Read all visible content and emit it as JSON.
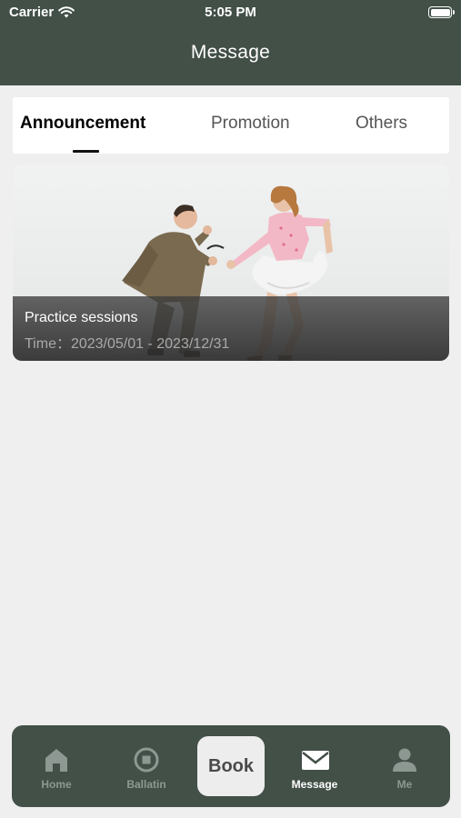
{
  "status_bar": {
    "carrier": "Carrier",
    "time": "5:05 PM"
  },
  "header": {
    "title": "Message"
  },
  "tabs": [
    {
      "label": "Announcement",
      "active": true
    },
    {
      "label": "Promotion",
      "active": false
    },
    {
      "label": "Others",
      "active": false
    }
  ],
  "announcements": [
    {
      "title": "Practice sessions",
      "time": "Time：2023/05/01 - 2023/12/31",
      "image": "dancing-couple-photo"
    }
  ],
  "tabbar": {
    "items": [
      {
        "label": "Home",
        "icon": "home-icon",
        "active": false
      },
      {
        "label": "Ballatin",
        "icon": "circle-stop-icon",
        "active": false
      },
      {
        "label": "Book",
        "icon": "",
        "active": false
      },
      {
        "label": "Message",
        "icon": "envelope-icon",
        "active": true
      },
      {
        "label": "Me",
        "icon": "person-icon",
        "active": false
      }
    ]
  },
  "colors": {
    "header_bg": "#425048",
    "tabbar_bg": "#425048",
    "page_bg": "#efefef",
    "tab_inactive": "#8e9893"
  }
}
